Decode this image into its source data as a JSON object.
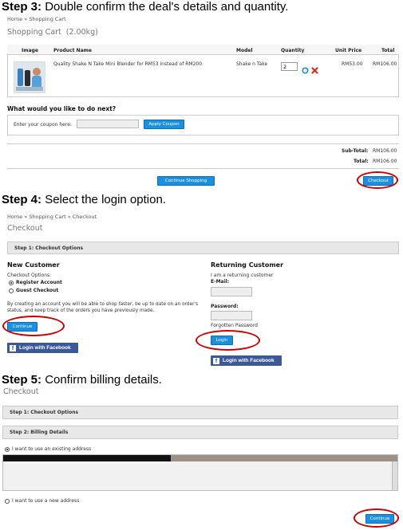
{
  "step3": {
    "label": "Step 3:",
    "text": "Double confirm the deal's details and quantity.",
    "breadcrumb": [
      "Home",
      "Shopping Cart"
    ],
    "page_title": "Shopping Cart",
    "weight": "(2.00kg)",
    "table": {
      "headers": [
        "Image",
        "Product Name",
        "Model",
        "Quantity",
        "Unit Price",
        "Total"
      ],
      "row": {
        "product_name": "Quality Shake N Take Mini Blender for RM53 instead of RM200",
        "model": "Shake n Take",
        "quantity": "2",
        "unit_price": "RM53.00",
        "total": "RM106.00"
      }
    },
    "next_heading": "What would you like to do next?",
    "coupon_label": "Enter your coupon here:",
    "apply_coupon": "Apply Coupon",
    "subtotal_label": "Sub-Total:",
    "subtotal_value": "RM106.00",
    "total_label": "Total:",
    "total_value": "RM106.00",
    "continue_shopping": "Continue Shopping",
    "checkout": "Checkout"
  },
  "step4": {
    "label": "Step 4:",
    "text": "Select the login option.",
    "breadcrumb": [
      "Home",
      "Shopping Cart",
      "Checkout"
    ],
    "page_title": "Checkout",
    "options_bar": "Step 1: Checkout Options",
    "new_customer": {
      "heading": "New Customer",
      "options_label": "Checkout Options:",
      "register": "Register Account",
      "guest": "Guest Checkout",
      "description": "By creating an account you will be able to shop faster, be up to date on an order's status, and keep track of the orders you have previously made.",
      "continue": "Continue",
      "facebook": "Login with Facebook"
    },
    "returning_customer": {
      "heading": "Returning Customer",
      "subtitle": "I am a returning customer",
      "email_label": "E-Mail:",
      "password_label": "Password:",
      "forgotten": "Forgotten Password",
      "login": "Login",
      "facebook": "Login with Facebook"
    }
  },
  "step5": {
    "label": "Step 5:",
    "text": "Confirm billing details.",
    "page_title": "Checkout",
    "bar1": "Step 1: Checkout Options",
    "bar2": "Step 2: Billing Details",
    "existing_address": "I want to use an existing address",
    "new_address": "I want to use a new address",
    "continue": "Continue"
  },
  "colors": {
    "button_blue": "#1b8fe0",
    "facebook_blue": "#3b5998",
    "highlight_red": "#cc0000"
  }
}
